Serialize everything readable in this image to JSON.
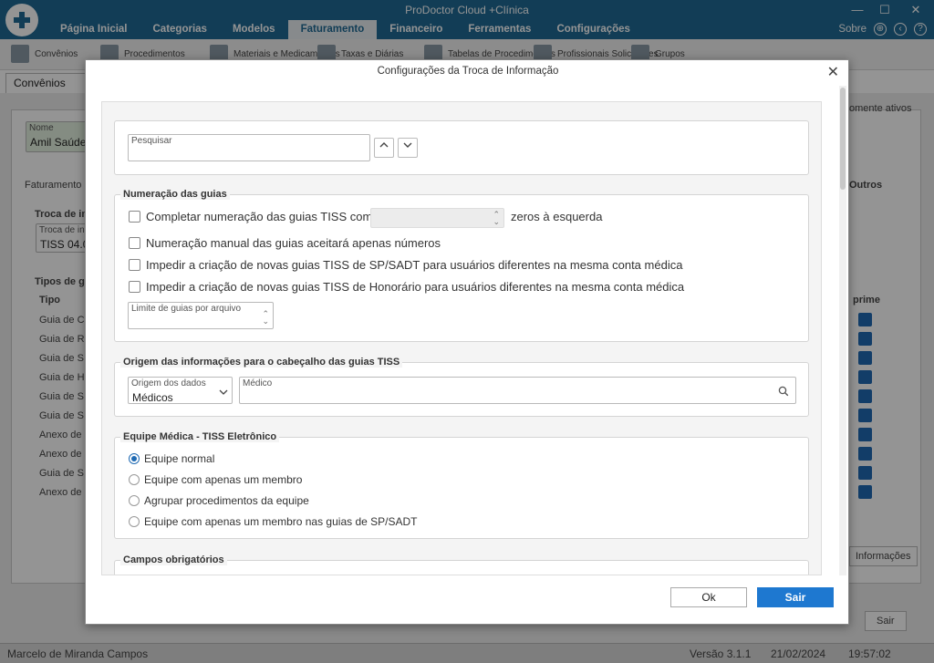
{
  "app": {
    "title": "ProDoctor Cloud +Clínica",
    "sobre": "Sobre"
  },
  "menu": [
    "Página Inicial",
    "Categorias",
    "Modelos",
    "Faturamento",
    "Financeiro",
    "Ferramentas",
    "Configurações"
  ],
  "menu_active": "Faturamento",
  "toolbar": [
    "Convênios",
    "Procedimentos",
    "Materiais e Medicamentos",
    "Taxas e Diárias",
    "Tabelas de Procedimentos",
    "Profissionais Solicitantes",
    "Grupos"
  ],
  "doc_tab": "Convênios",
  "background": {
    "nome_label": "Nome",
    "nome_value": "Amil Saúde",
    "faturamento": "Faturamento",
    "troca_de_info": "Troca de inf",
    "troca_label": "Troca de in",
    "troca_value": "TISS 04.0",
    "tipos_de_guias": "Tipos de gu",
    "tipo_header": "Tipo",
    "rows": [
      "Guia de C",
      "Guia de R",
      "Guia de S",
      "Guia de H",
      "Guia de S",
      "Guia de S",
      "Anexo de",
      "Anexo de",
      "Guia de S",
      "Anexo de"
    ],
    "somente_ativos": "omente ativos",
    "outros": "Outros",
    "imprime": "prime",
    "informacoes_btn": "Informações",
    "sair_btn": "Sair"
  },
  "status": {
    "user": "Marcelo de Miranda Campos",
    "version": "Versão 3.1.1",
    "date": "21/02/2024",
    "time": "19:57:02"
  },
  "dialog": {
    "title": "Configurações da Troca de Informação",
    "search_label": "Pesquisar",
    "numeracao": {
      "title": "Numeração das guias",
      "opt1": "Completar numeração das guias TISS com",
      "opt1_suffix": "zeros à esquerda",
      "opt2": "Numeração manual das guias aceitará apenas números",
      "opt3": "Impedir a criação de novas guias TISS de SP/SADT para usuários diferentes na mesma conta médica",
      "opt4": "Impedir a criação de novas guias TISS de Honorário para usuários diferentes na mesma conta médica",
      "limite_label": "Limite de guias por arquivo"
    },
    "origem": {
      "title": "Origem das informações para o cabeçalho das guias TISS",
      "origem_label": "Origem dos dados",
      "origem_value": "Médicos",
      "medico_label": "Médico"
    },
    "equipe": {
      "title": "Equipe Médica - TISS Eletrônico",
      "options": [
        "Equipe normal",
        "Equipe com apenas um membro",
        "Agrupar procedimentos da equipe",
        "Equipe com apenas um membro nas guias de SP/SADT"
      ],
      "selected": 0
    },
    "campos": {
      "title": "Campos obrigatórios"
    },
    "ok": "Ok",
    "sair": "Sair"
  }
}
